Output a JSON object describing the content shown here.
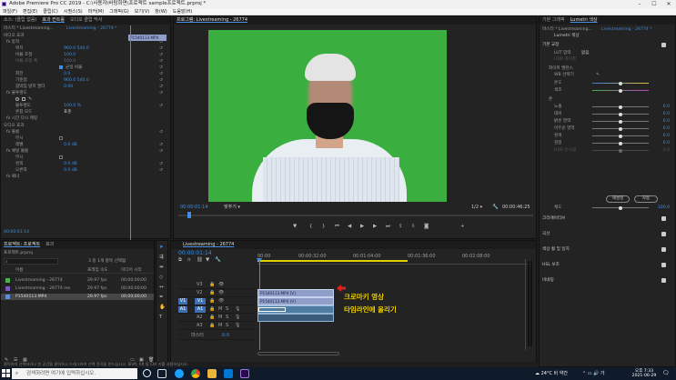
{
  "window": {
    "title": "Adobe Premiere Pro CC 2019 - C:\\사용자\\바탕화면\\프로젝트 sample프로젝트.prproj *"
  },
  "menu": [
    "파일(F)",
    "편집(E)",
    "클립(C)",
    "시퀀스(S)",
    "마커(M)",
    "그래픽(G)",
    "보기(V)",
    "창(W)",
    "도움말(H)"
  ],
  "effect_controls": {
    "tabs": [
      "소스: (클립 없음)",
      "효과 컨트롤",
      "오디오 클립 믹서"
    ],
    "source": "마스터 * Livestreaming...",
    "sequence": "Livestreaming - 26774 *",
    "clip_label": "P1540113.MP4",
    "section_video": "비디오 효과",
    "rows": [
      {
        "label": "fx 동작",
        "value": ""
      },
      {
        "label": "위치",
        "value": "960.0   540.0"
      },
      {
        "label": "비율 조정",
        "value": "100.0"
      },
      {
        "label": "비율 조정 폭",
        "value": "100.0"
      },
      {
        "label": "",
        "value": "균일 비율"
      },
      {
        "label": "회전",
        "value": "0.0"
      },
      {
        "label": "기준점",
        "value": "960.0   540.0"
      },
      {
        "label": "깜박임 방지 필터",
        "value": "0.00"
      },
      {
        "label": "fx 불투명도",
        "value": ""
      },
      {
        "label": "",
        "value": ""
      },
      {
        "label": "불투명도",
        "value": "100.0 %"
      },
      {
        "label": "혼합 모드",
        "value": "표준"
      },
      {
        "label": "fx 시간 다시 매핑",
        "value": ""
      }
    ],
    "section_audio": "오디오 효과",
    "audio_rows": [
      {
        "label": "fx 볼륨",
        "value": ""
      },
      {
        "label": "무시",
        "value": ""
      },
      {
        "label": "레벨",
        "value": "0.0 dB"
      },
      {
        "label": "fx 채널 볼륨",
        "value": ""
      },
      {
        "label": "무시",
        "value": ""
      },
      {
        "label": "왼쪽",
        "value": "0.0 dB"
      },
      {
        "label": "오른쪽",
        "value": "0.0 dB"
      },
      {
        "label": "fx 패너",
        "value": ""
      }
    ],
    "timecode": "00:00:01:14"
  },
  "program": {
    "tab": "프로그램: Livestreaming - 26774",
    "timecode": "00:00:01:14",
    "fit": "맞추기",
    "quality": "1/2",
    "duration": "00:00:46:25"
  },
  "project": {
    "tabs": [
      "프로젝트: 프로젝트",
      "효과"
    ],
    "path": "프로젝트.prproj",
    "selected_info": "3 중 1개 항목 선택됨",
    "columns": [
      "이름",
      "프레임 속도",
      "미디어 시작"
    ],
    "items": [
      {
        "name": "Livestreaming - 26774",
        "fps": "29.97 fps",
        "start": "00;00;00;00",
        "color": "#4caf50"
      },
      {
        "name": "Livestreaming - 26774 res",
        "fps": "29.97 fps",
        "start": "00;00;00;00",
        "color": "#7e57c2"
      },
      {
        "name": "P1540113.MP4",
        "fps": "29.97 fps",
        "start": "00;00;00;00",
        "color": "#5c8dd6"
      }
    ]
  },
  "timeline": {
    "tab": "Livestreaming - 26774",
    "timecode": "00:00:01:14",
    "ruler": [
      "00:00",
      "00:00:32:00",
      "00:01:04:00",
      "00:01:36:00",
      "00:02:08:00"
    ],
    "video_tracks": [
      "V3",
      "V2",
      "V1"
    ],
    "audio_tracks": [
      "A1",
      "A2",
      "A3"
    ],
    "master": "마스터",
    "master_value": "0.0",
    "clip_top": "P1540113.MP4 [V]",
    "clip_mid": "P1540113.MP4 [V]",
    "clip_small": "P1540113.MP4",
    "annotation_line1": "크로마키 영상",
    "annotation_line2": "타임라인에 올리기",
    "colors": {
      "annotation_text": "#f5d700",
      "arrow": "#e02020"
    }
  },
  "lumetri": {
    "tabs": [
      "기본 그래픽",
      "Lumetri 색상"
    ],
    "source": "마스터 * Livestreaming...",
    "sequence": "Livestreaming - 26774 *",
    "clip_label": "Lumetri 색상",
    "sections": [
      "기본 교정",
      "크리에이티브",
      "곡선",
      "색상 휠 및 일치",
      "HSL 보조",
      "비네팅"
    ],
    "lut_label": "LUT 입력",
    "lut_value": "없음",
    "hdr_label": "HDR 화이트",
    "wb": "화이트 밸런스",
    "wb_picker": "WB 선택기",
    "temp": "온도",
    "tint": "색조",
    "tone": "톤",
    "sliders": [
      "노출",
      "대비",
      "밝은 영역",
      "어두운 영역",
      "흰색",
      "검정",
      "HDR 반사광"
    ],
    "slider_values": [
      "0.0",
      "0.0",
      "0.0",
      "0.0",
      "0.0",
      "0.0",
      "0.0"
    ],
    "reset": "재설정",
    "auto": "자동",
    "saturation": "채도",
    "saturation_value": "100.0"
  },
  "taskbar": {
    "search": "검색하려면 여기에 입력하십시오.",
    "weather": "24°C 비 약간",
    "time": "오후 7:33",
    "date": "2021-06-29"
  },
  "status": "클릭하여 선택하거나 빈 공간을 클릭하고 드래그하여 선택 윤곽을 만드십시오. Shift, Alt 및 Ctrl 키를 사용하십시오."
}
